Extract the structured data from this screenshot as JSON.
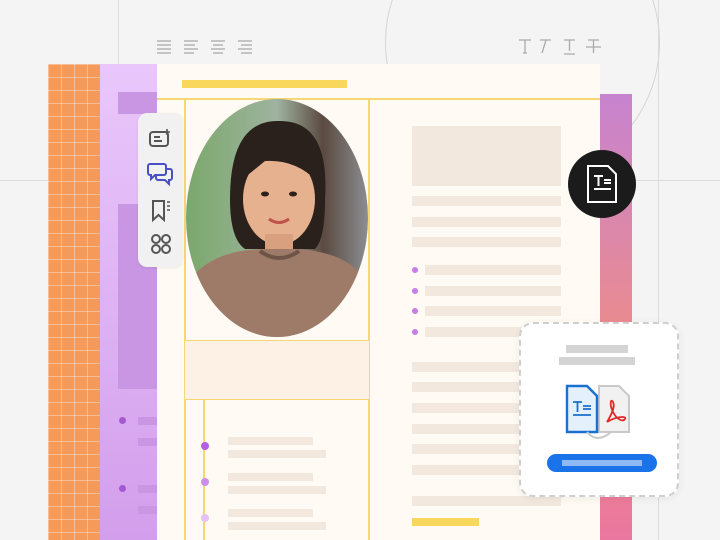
{
  "colors": {
    "background": "#f4f4f4",
    "orange_panel": "#f59a58",
    "purple_panel": "#d8a4ef",
    "document": "#fffaf3",
    "accent_yellow": "#f9d65c",
    "placeholder": "#f2e8de",
    "bullet": "#c77de6",
    "primary_blue": "#1a73e8",
    "dark_badge": "#1b1b1b"
  },
  "top_toolbar": {
    "align_icons": [
      "align-left-icon",
      "align-justify-icon",
      "align-center-icon",
      "align-right-icon"
    ],
    "text_icons": [
      "text-icon",
      "italic-text-icon",
      "underline-text-icon",
      "strikethrough-text-icon"
    ]
  },
  "side_toolbar": {
    "icons": [
      "edit-text-icon",
      "comment-icon",
      "bookmark-icon",
      "apps-icon"
    ],
    "active": "comment-icon"
  },
  "badge_icon": "text-document-icon",
  "convert_card": {
    "icons": [
      "text-document-icon",
      "pdf-icon",
      "convert-arrow-icon"
    ],
    "progress": 1.0
  }
}
